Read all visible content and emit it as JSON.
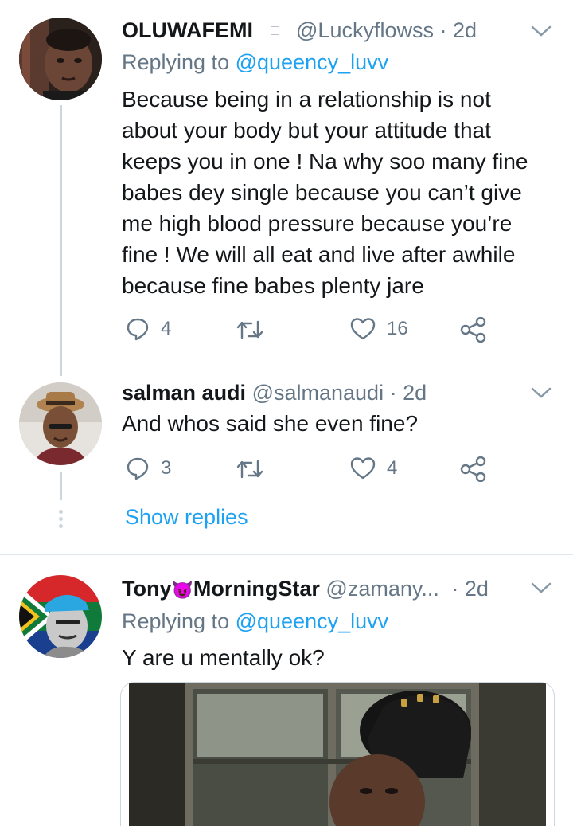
{
  "tweets": [
    {
      "name": "OLUWAFEMI",
      "handle": "@Luckyflowss",
      "time": "· 2d",
      "replying_prefix": "Replying to ",
      "replying_to": "@queency_luvv",
      "text": "Because being in a relationship is not about your body but your attitude that keeps you in one ! Na why soo many fine babes dey single because you can’t give me high blood pressure because you’re fine ! We will all eat and live after awhile because fine babes plenty jare",
      "replies": "4",
      "likes": "16"
    },
    {
      "name": "salman audi",
      "handle": "@salmanaudi",
      "time": "· 2d",
      "text": "And whos said she even fine?",
      "replies": "3",
      "likes": "4"
    },
    {
      "name_part1": "Tony",
      "emoji": "😈",
      "name_part2": "MorningStar",
      "handle": "@zamany...",
      "time": "· 2d",
      "replying_prefix": "Replying to ",
      "replying_to": "@queency_luvv",
      "text": "Y are u mentally ok?"
    }
  ],
  "show_replies": "Show replies",
  "colors": {
    "accent": "#1da1f2",
    "secondary": "#657786",
    "thread": "#ccd6dd"
  },
  "icons": [
    "reply-icon",
    "retweet-icon",
    "like-icon",
    "share-icon",
    "chevron-down-icon",
    "verified-dot-icon"
  ]
}
